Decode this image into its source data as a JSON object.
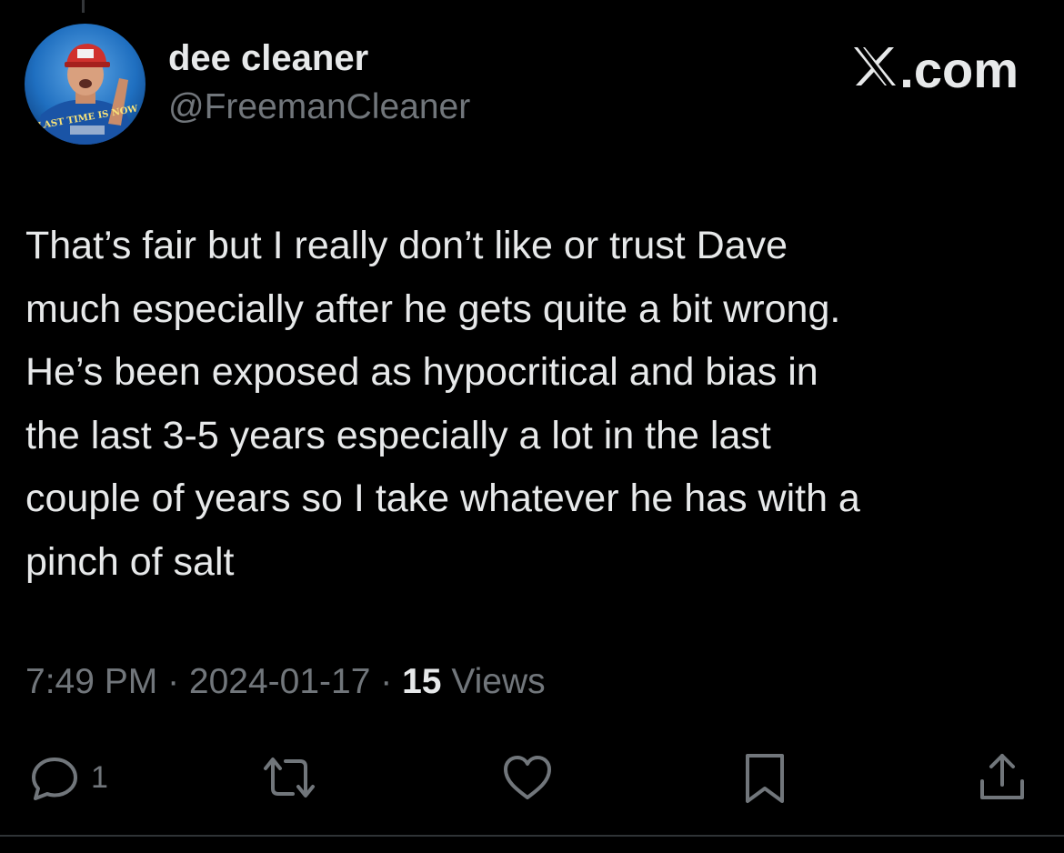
{
  "author": {
    "display_name": "dee cleaner",
    "handle": "@FreemanCleaner",
    "avatar_shirt_text": "LAST TIME IS NOW"
  },
  "brand": {
    "label": ".com",
    "x_glyph": "𝕏"
  },
  "tweet": {
    "lines": [
      "That’s fair but I really don’t like or trust Dave",
      "much especially after he gets quite a bit wrong.",
      "He’s been exposed as hypocritical and bias in",
      "the last 3-5 years especially a lot in the last",
      "couple of years so I take whatever he has with a",
      "pinch of salt"
    ]
  },
  "meta": {
    "time": "7:49 PM",
    "separator": " · ",
    "date": "2024-01-17",
    "views_count": "15",
    "views_label": " Views"
  },
  "actions": {
    "reply_icon": "reply-icon",
    "reply_count": "1",
    "retweet_icon": "retweet-icon",
    "like_icon": "heart-icon",
    "bookmark_icon": "bookmark-icon",
    "share_icon": "share-icon"
  },
  "colors": {
    "background": "#000000",
    "primary_text": "#e7e9ea",
    "secondary_text": "#71767b",
    "avatar_bg": "#1d5fa8",
    "cap_red": "#d0312d"
  }
}
